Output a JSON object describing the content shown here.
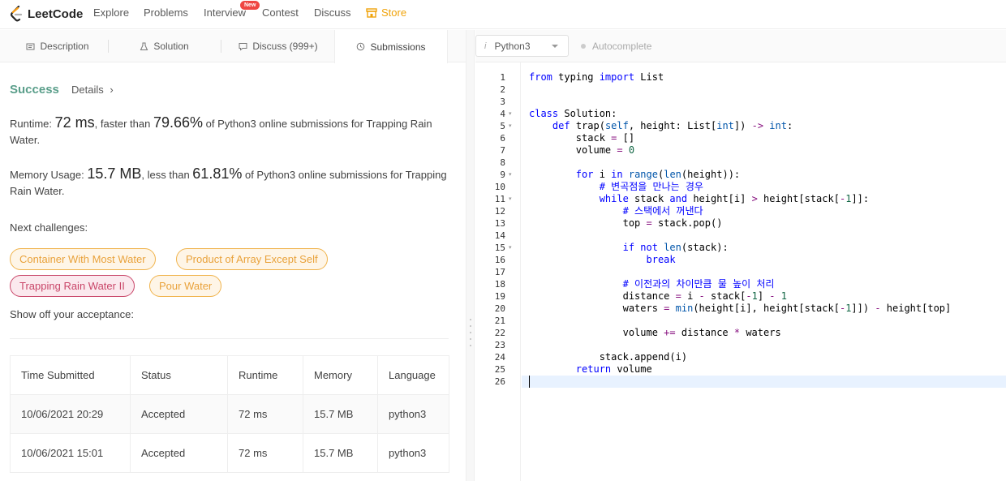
{
  "nav": {
    "logo": "LeetCode",
    "items": [
      "Explore",
      "Problems",
      "Interview",
      "Contest",
      "Discuss"
    ],
    "new_badge": "New",
    "store": "Store"
  },
  "tabs": {
    "description": "Description",
    "solution": "Solution",
    "discuss": "Discuss (999+)",
    "submissions": "Submissions"
  },
  "result": {
    "status": "Success",
    "details": "Details",
    "runtime_label": "Runtime: ",
    "runtime_value": "72 ms",
    "runtime_mid": ", faster than ",
    "runtime_pct": "79.66%",
    "runtime_tail": " of Python3 online submissions for Trapping Rain Water.",
    "memory_label": "Memory Usage: ",
    "memory_value": "15.7 MB",
    "memory_mid": ", less than ",
    "memory_pct": "61.81%",
    "memory_tail": " of Python3 online submissions for Trapping Rain Water.",
    "next_label": "Next challenges:",
    "challenges": [
      {
        "label": "Container With Most Water",
        "difficulty": "medium"
      },
      {
        "label": "Product of Array Except Self",
        "difficulty": "medium"
      },
      {
        "label": "Trapping Rain Water II",
        "difficulty": "hard"
      },
      {
        "label": "Pour Water",
        "difficulty": "medium"
      }
    ],
    "showoff": "Show off your acceptance:"
  },
  "table": {
    "headers": [
      "Time Submitted",
      "Status",
      "Runtime",
      "Memory",
      "Language"
    ],
    "rows": [
      [
        "10/06/2021 20:29",
        "Accepted",
        "72 ms",
        "15.7 MB",
        "python3"
      ],
      [
        "10/06/2021 15:01",
        "Accepted",
        "72 ms",
        "15.7 MB",
        "python3"
      ]
    ]
  },
  "editor": {
    "language": "Python3",
    "autocomplete": "Autocomplete",
    "line_count": 26,
    "fold_lines": [
      4,
      5,
      9,
      11,
      15
    ],
    "active_line": 26,
    "code": [
      "from typing import List",
      "",
      "",
      "class Solution:",
      "    def trap(self, height: List[int]) -> int:",
      "        stack = []",
      "        volume = 0",
      "",
      "        for i in range(len(height)):",
      "            # 변곡점을 만나는 경우",
      "            while stack and height[i] > height[stack[-1]]:",
      "                # 스택에서 꺼낸다",
      "                top = stack.pop()",
      "",
      "                if not len(stack):",
      "                    break",
      "",
      "                # 이전과의 차이만큼 물 높이 처리",
      "                distance = i - stack[-1] - 1",
      "                waters = min(height[i], height[stack[-1]]) - height[top]",
      "",
      "                volume += distance * waters",
      "",
      "            stack.append(i)",
      "        return volume",
      ""
    ]
  }
}
